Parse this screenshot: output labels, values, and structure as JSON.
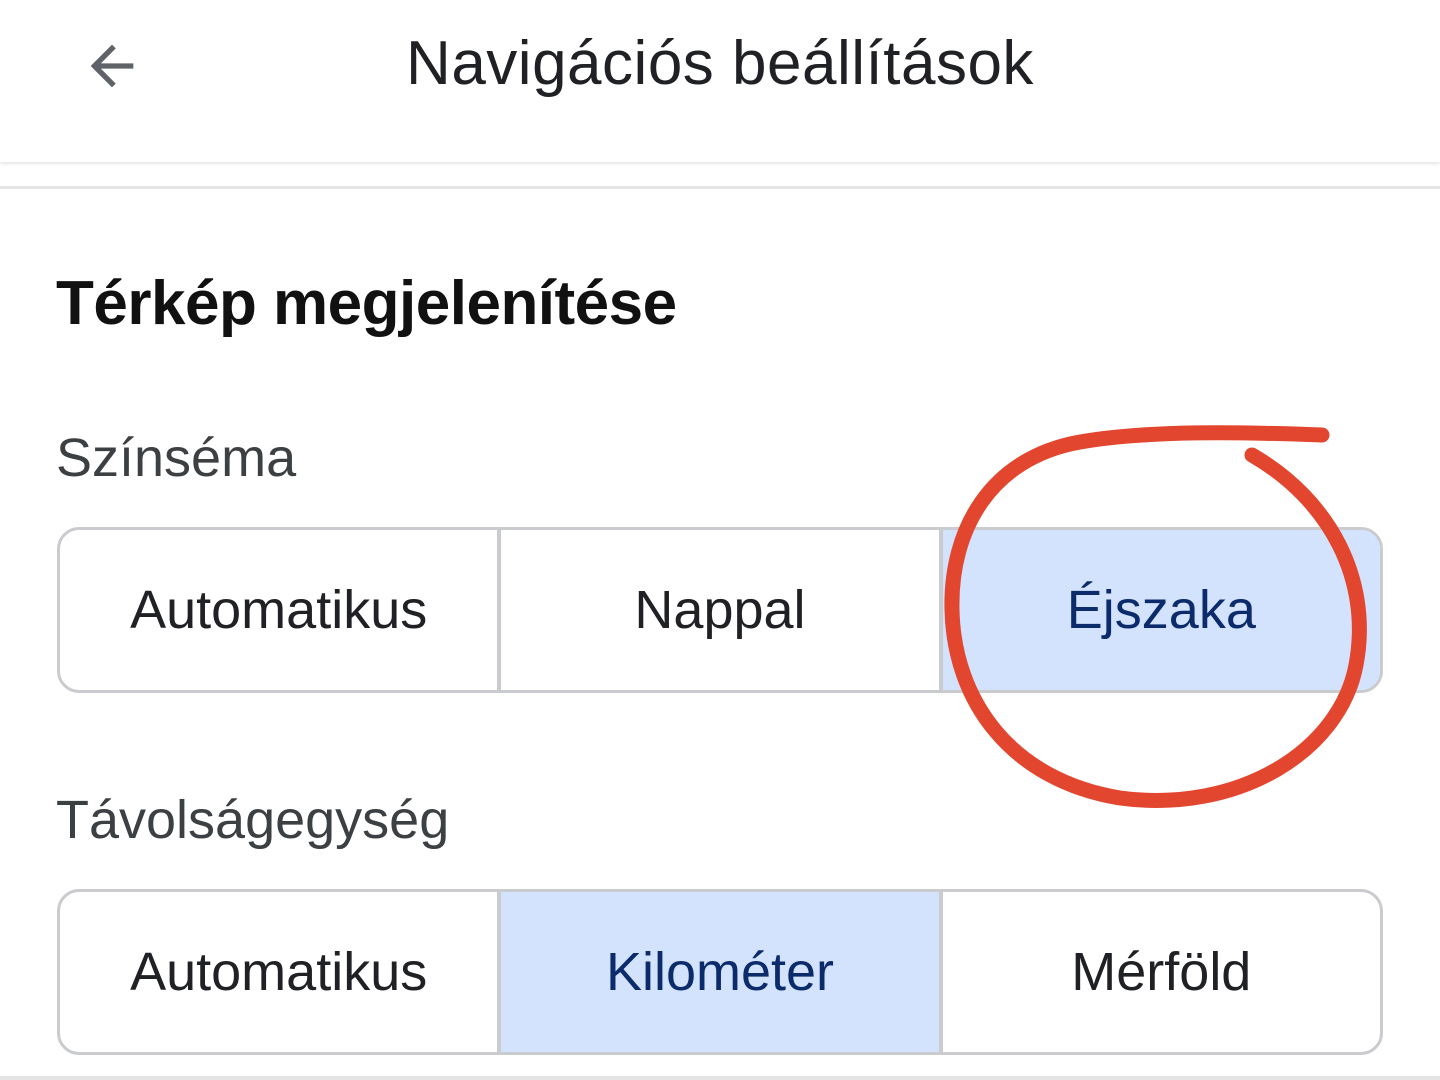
{
  "header": {
    "title": "Navigációs beállítások",
    "back_icon": "arrow-back-icon"
  },
  "section": {
    "title": "Térkép megjelenítése"
  },
  "color_scheme": {
    "label": "Színséma",
    "options": [
      "Automatikus",
      "Nappal",
      "Éjszaka"
    ],
    "selected": "Éjszaka"
  },
  "distance_unit": {
    "label": "Távolságegység",
    "options": [
      "Automatikus",
      "Kilométer",
      "Mérföld"
    ],
    "selected": "Kilométer"
  },
  "colors": {
    "selected_background": "#d3e3fd",
    "selected_text": "#0b2b6b",
    "annotation": "#e2462e"
  }
}
